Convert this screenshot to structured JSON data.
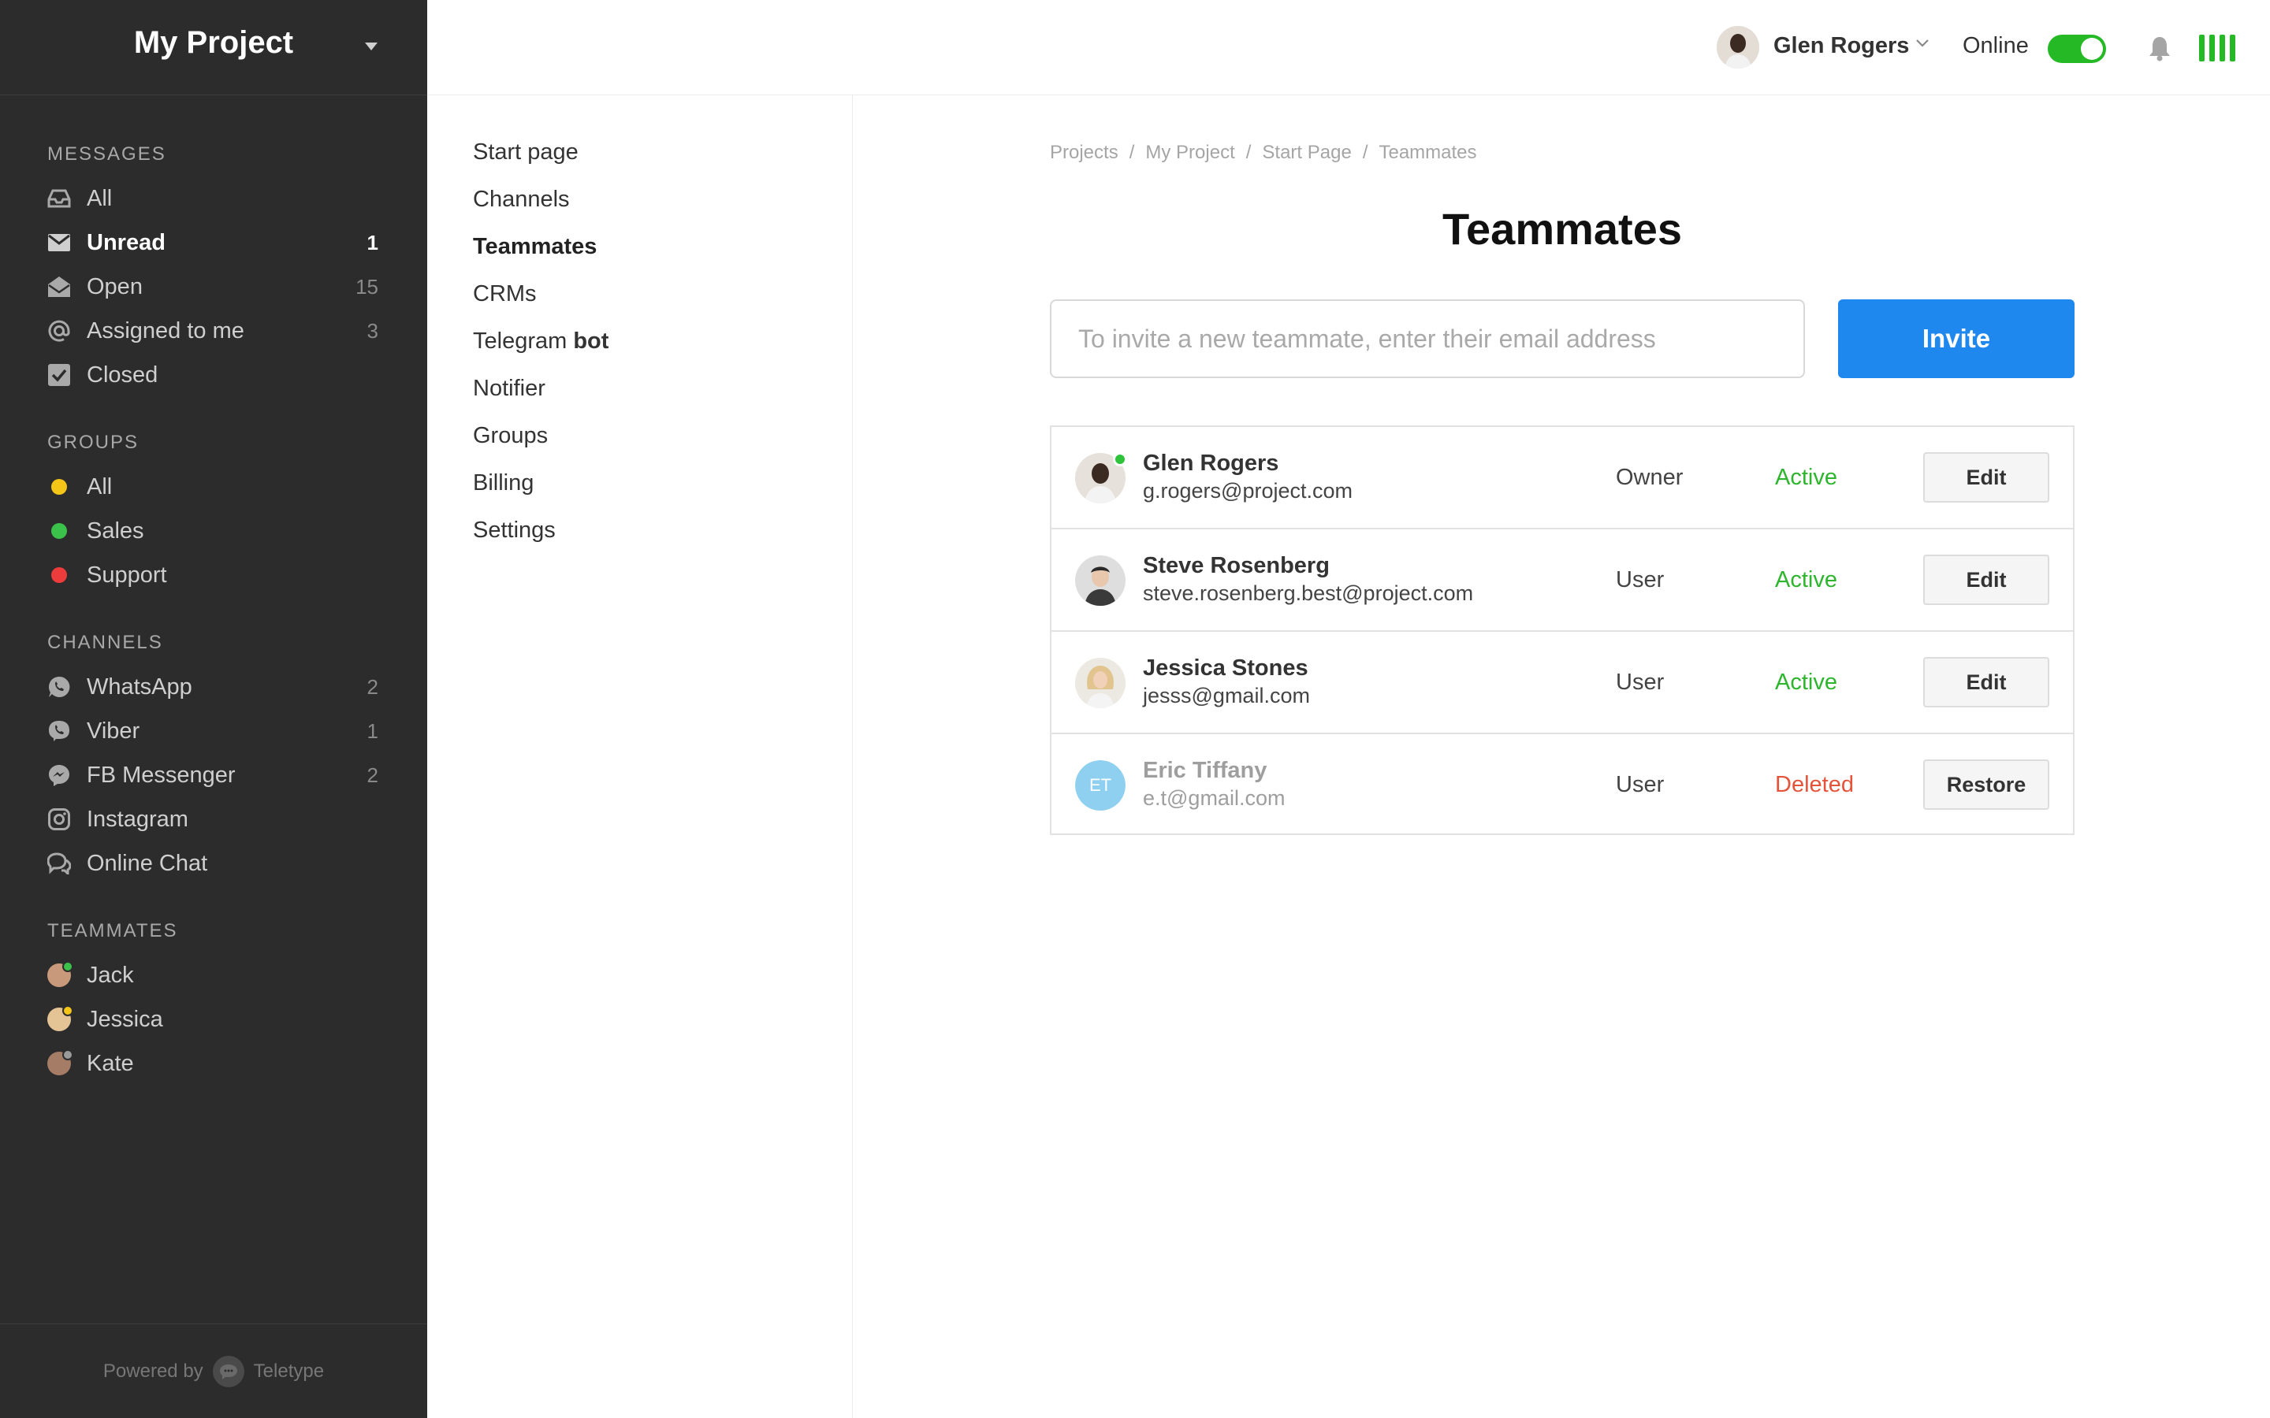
{
  "project": {
    "title": "My Project"
  },
  "sidebar": {
    "messages_title": "MESSAGES",
    "messages": [
      {
        "label": "All",
        "count": "",
        "icon": "inbox-icon"
      },
      {
        "label": "Unread",
        "count": "1",
        "icon": "envelope-icon"
      },
      {
        "label": "Open",
        "count": "15",
        "icon": "open-envelope-icon"
      },
      {
        "label": "Assigned to me",
        "count": "3",
        "icon": "at-icon"
      },
      {
        "label": "Closed",
        "count": "",
        "icon": "checkbox-icon"
      }
    ],
    "groups_title": "GROUPS",
    "groups": [
      {
        "label": "All",
        "color": "#f5c518"
      },
      {
        "label": "Sales",
        "color": "#3bc24a"
      },
      {
        "label": "Support",
        "color": "#ee3b3b"
      }
    ],
    "channels_title": "CHANNELS",
    "channels": [
      {
        "label": "WhatsApp",
        "count": "2",
        "icon": "whatsapp-icon"
      },
      {
        "label": "Viber",
        "count": "1",
        "icon": "viber-icon"
      },
      {
        "label": "FB Messenger",
        "count": "2",
        "icon": "messenger-icon"
      },
      {
        "label": "Instagram",
        "count": "",
        "icon": "instagram-icon"
      },
      {
        "label": "Online Chat",
        "count": "",
        "icon": "chat-icon"
      }
    ],
    "teammates_title": "TEAMMATES",
    "teammates": [
      {
        "label": "Jack",
        "status_color": "#3bc24a"
      },
      {
        "label": "Jessica",
        "status_color": "#f5c518"
      },
      {
        "label": "Kate",
        "status_color": "#9a9a9a"
      }
    ],
    "powered_by": "Powered by",
    "brand": "Teletype"
  },
  "topbar": {
    "user_name": "Glen Rogers",
    "online_label": "Online",
    "online_enabled": true
  },
  "settings_nav": {
    "items": [
      {
        "label": "Start page"
      },
      {
        "label": "Channels"
      },
      {
        "label": "Teammates",
        "active": true
      },
      {
        "label": "CRMs"
      },
      {
        "label": "Telegram",
        "suffix": "bot"
      },
      {
        "label": "Notifier"
      },
      {
        "label": "Groups"
      },
      {
        "label": "Billing"
      },
      {
        "label": "Settings"
      }
    ]
  },
  "breadcrumb": [
    "Projects",
    "My Project",
    "Start Page",
    "Teammates"
  ],
  "breadcrumb_sep": "/",
  "page": {
    "title": "Teammates",
    "invite_placeholder": "To invite a new teammate, enter their email address",
    "invite_value": "",
    "invite_button": "Invite"
  },
  "teammates": [
    {
      "name": "Glen Rogers",
      "email": "g.rogers@project.com",
      "role": "Owner",
      "status": "Active",
      "status_color": "#2db52d",
      "action": "Edit",
      "online": true
    },
    {
      "name": "Steve Rosenberg",
      "email": "steve.rosenberg.best@project.com",
      "role": "User",
      "status": "Active",
      "status_color": "#2db52d",
      "action": "Edit",
      "online": false
    },
    {
      "name": "Jessica Stones",
      "email": "jesss@gmail.com",
      "role": "User",
      "status": "Active",
      "status_color": "#2db52d",
      "action": "Edit",
      "online": false
    },
    {
      "name": "Eric Tiffany",
      "email": "e.t@gmail.com",
      "role": "User",
      "status": "Deleted",
      "status_color": "#e5533b",
      "action": "Restore",
      "initials": "ET",
      "online": false
    }
  ]
}
